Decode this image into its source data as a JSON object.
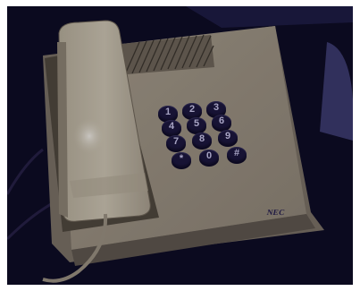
{
  "brand": "NEC",
  "keypad": {
    "keys": [
      "1",
      "2",
      "3",
      "4",
      "5",
      "6",
      "7",
      "8",
      "9",
      "*",
      "0",
      "#"
    ]
  },
  "colors": {
    "background": "#0c0b1e",
    "phone_body": "#b8ae94",
    "handset": "#c7c0a7",
    "keys": "#1a1638",
    "key_text": "#c9c6e6"
  }
}
